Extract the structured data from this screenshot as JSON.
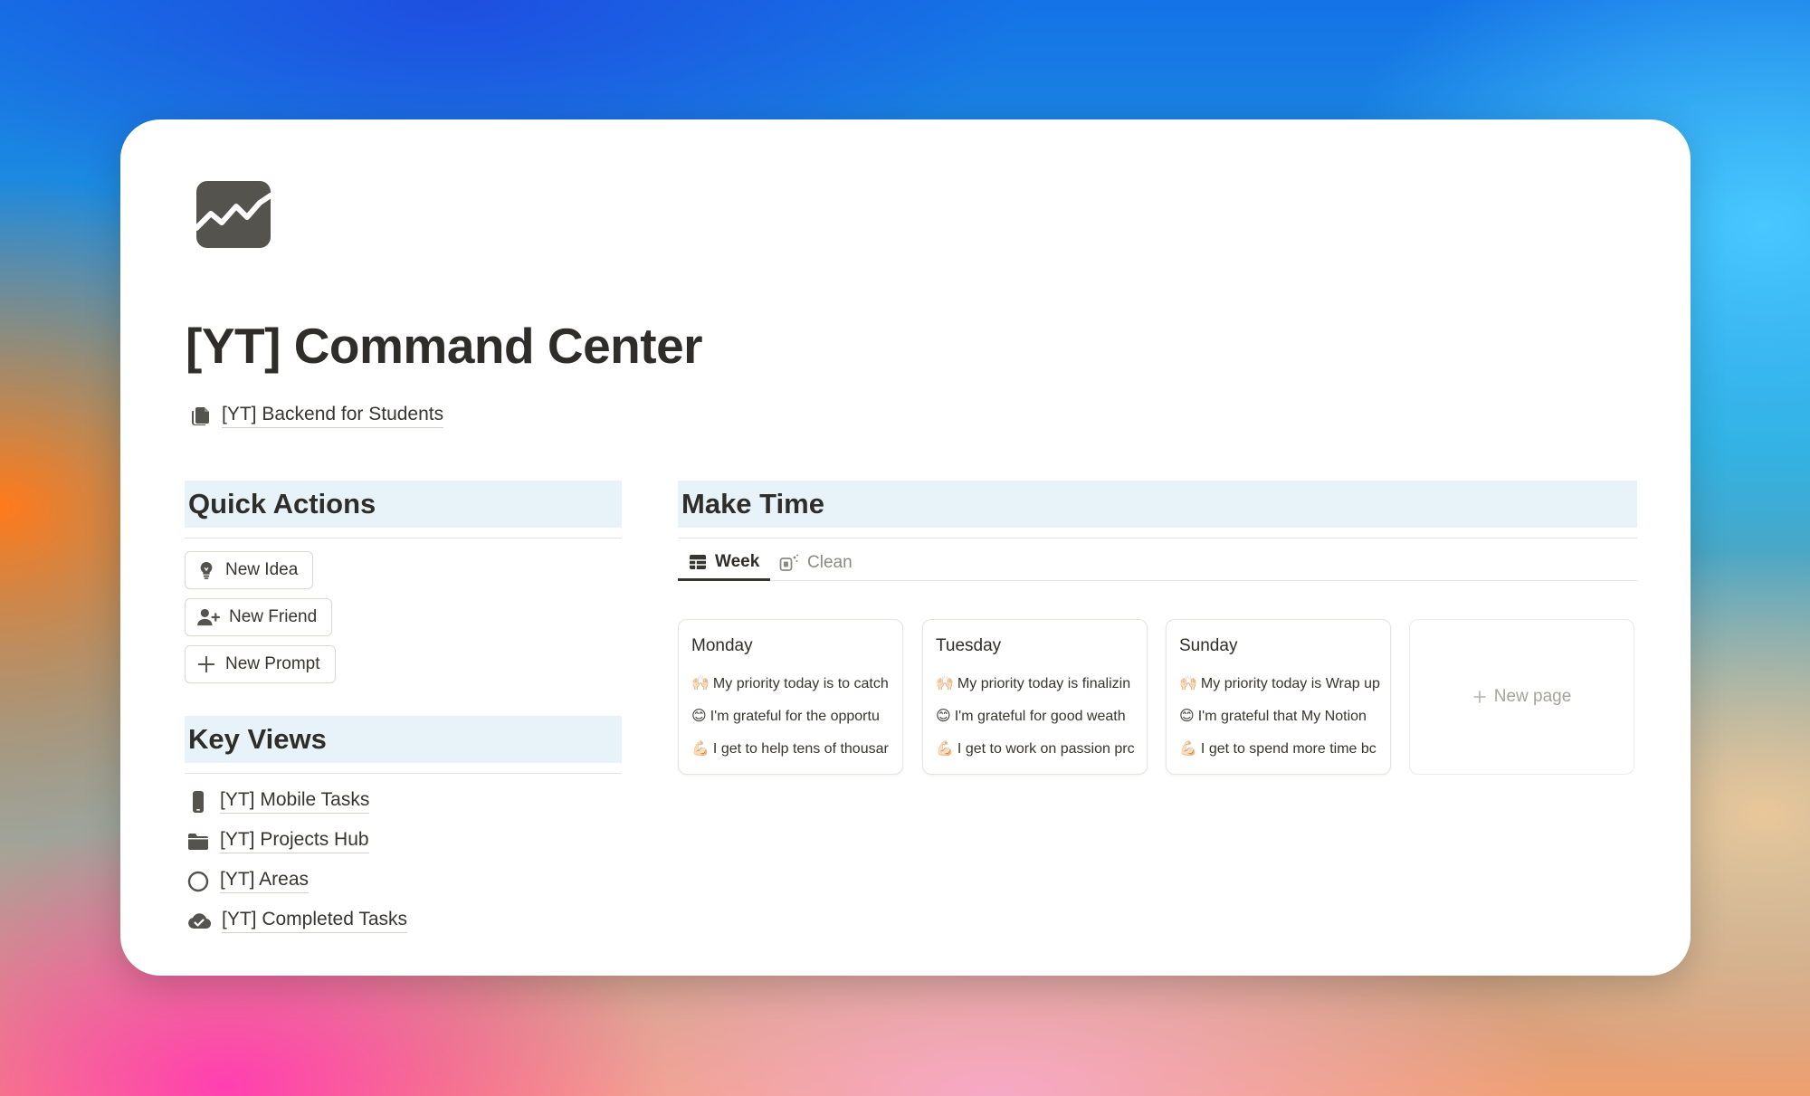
{
  "page": {
    "title": "[YT] Command Center",
    "icon": "chart-line-icon",
    "backend_link": {
      "label": "[YT] Backend for Students",
      "icon": "documents-icon"
    }
  },
  "quick_actions": {
    "heading": "Quick Actions",
    "buttons": [
      {
        "label": "New Idea",
        "icon": "lightbulb-icon"
      },
      {
        "label": "New Friend",
        "icon": "add-user-icon"
      },
      {
        "label": "New Prompt",
        "icon": "plus-icon"
      }
    ]
  },
  "key_views": {
    "heading": "Key Views",
    "items": [
      {
        "label": "[YT] Mobile Tasks",
        "icon": "mobile-icon"
      },
      {
        "label": "[YT] Projects Hub",
        "icon": "folder-icon"
      },
      {
        "label": "[YT] Areas",
        "icon": "circle-icon"
      },
      {
        "label": "[YT] Completed Tasks",
        "icon": "cloud-check-icon"
      }
    ]
  },
  "make_time": {
    "heading": "Make Time",
    "tabs": [
      {
        "label": "Week",
        "icon": "table-icon",
        "active": true
      },
      {
        "label": "Clean",
        "icon": "sparkle-icon",
        "active": false
      }
    ],
    "cards": [
      {
        "day": "Monday",
        "lines": [
          {
            "emoji": "🙌🏻",
            "text": "My priority today is to catch"
          },
          {
            "emoji": "😊",
            "text": "I'm grateful for the opportu"
          },
          {
            "emoji": "💪🏻",
            "text": "I get to help tens of thousar"
          }
        ]
      },
      {
        "day": "Tuesday",
        "lines": [
          {
            "emoji": "🙌🏻",
            "text": "My priority today is finalizin"
          },
          {
            "emoji": "😊",
            "text": "I'm grateful for good weath"
          },
          {
            "emoji": "💪🏻",
            "text": "I get to work on passion prc"
          }
        ]
      },
      {
        "day": "Sunday",
        "lines": [
          {
            "emoji": "🙌🏻",
            "text": "My priority today is Wrap up"
          },
          {
            "emoji": "😊",
            "text": "I'm grateful that My Notion"
          },
          {
            "emoji": "💪🏻",
            "text": "I get to spend more time bc"
          }
        ]
      }
    ],
    "new_page": {
      "label": "New page",
      "icon": "plus-icon"
    }
  },
  "colors": {
    "text": "#37352f",
    "heading_bg": "#e7f3f8",
    "icon_gray": "#55534e"
  }
}
